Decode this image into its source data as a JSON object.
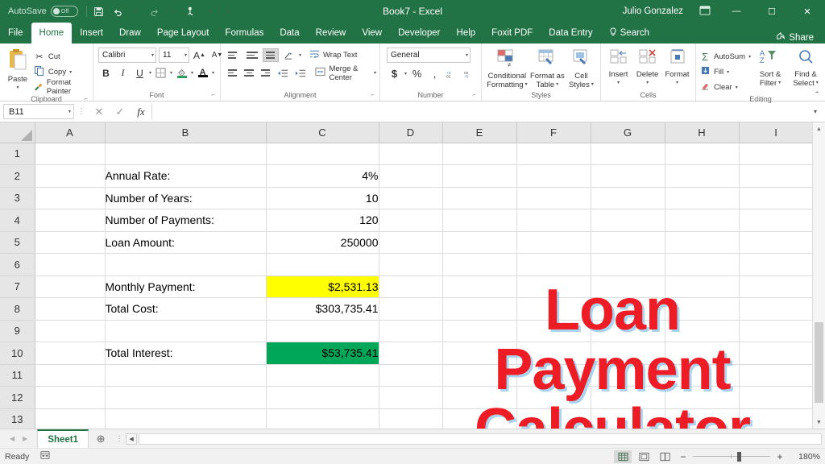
{
  "titlebar": {
    "autosave_label": "AutoSave",
    "autosave_state": "Off",
    "save_icon": "save-icon",
    "undo_icon": "undo-icon",
    "redo_icon": "redo-icon",
    "touch_icon": "touch-mode-icon",
    "customize_icon": "customize-qat-icon",
    "title": "Book7  -  Excel",
    "user": "Julio Gonzalez",
    "ribbon_display_icon": "ribbon-display-options-icon",
    "minimize": "—",
    "maximize": "☐",
    "close": "✕"
  },
  "tabs": [
    {
      "label": "File",
      "active": false
    },
    {
      "label": "Home",
      "active": true
    },
    {
      "label": "Insert",
      "active": false
    },
    {
      "label": "Draw",
      "active": false
    },
    {
      "label": "Page Layout",
      "active": false
    },
    {
      "label": "Formulas",
      "active": false
    },
    {
      "label": "Data",
      "active": false
    },
    {
      "label": "Review",
      "active": false
    },
    {
      "label": "View",
      "active": false
    },
    {
      "label": "Developer",
      "active": false
    },
    {
      "label": "Help",
      "active": false
    },
    {
      "label": "Foxit PDF",
      "active": false
    },
    {
      "label": "Data Entry",
      "active": false
    }
  ],
  "search": {
    "label": "Search",
    "icon": "lightbulb-icon"
  },
  "share": {
    "label": "Share",
    "icon": "share-icon"
  },
  "ribbon": {
    "clipboard": {
      "group_label": "Clipboard",
      "paste_label": "Paste",
      "cut_label": "Cut",
      "copy_label": "Copy",
      "format_painter_label": "Format Painter"
    },
    "font": {
      "group_label": "Font",
      "font_name": "Calibri",
      "font_size": "11",
      "grow_label": "A",
      "shrink_label": "A",
      "bold_label": "B",
      "italic_label": "I",
      "underline_label": "U",
      "borders_icon": "borders-icon",
      "fill_color_icon": "fill-color-icon",
      "font_color_icon": "font-color-icon",
      "fill_color": "#2e9e5b",
      "font_color": "#000000"
    },
    "alignment": {
      "group_label": "Alignment",
      "wrap_text_label": "Wrap Text",
      "merge_center_label": "Merge & Center",
      "orientation_icon": "orientation-icon",
      "decrease_indent_icon": "decrease-indent-icon",
      "increase_indent_icon": "increase-indent-icon"
    },
    "number": {
      "group_label": "Number",
      "format": "General",
      "currency_label": "$",
      "percent_label": "%",
      "comma_label": ",",
      "increase_decimal_icon": "increase-decimal-icon",
      "decrease_decimal_icon": "decrease-decimal-icon"
    },
    "styles": {
      "group_label": "Styles",
      "conditional_formatting_label": "Conditional\nFormatting",
      "conditional_formatting_l1": "Conditional",
      "conditional_formatting_l2": "Formatting",
      "format_as_table_l1": "Format as",
      "format_as_table_l2": "Table",
      "cell_styles_l1": "Cell",
      "cell_styles_l2": "Styles"
    },
    "cells": {
      "group_label": "Cells",
      "insert_label": "Insert",
      "delete_label": "Delete",
      "format_label": "Format"
    },
    "editing": {
      "group_label": "Editing",
      "autosum_label": "AutoSum",
      "fill_label": "Fill",
      "clear_label": "Clear",
      "sort_filter_l1": "Sort &",
      "sort_filter_l2": "Filter",
      "find_select_l1": "Find &",
      "find_select_l2": "Select",
      "collapse_icon": "collapse-ribbon-icon"
    }
  },
  "formulabar": {
    "name_box_value": "B11",
    "cancel_icon": "cancel-icon",
    "enter_icon": "enter-icon",
    "fx_icon": "insert-function-icon",
    "formula_value": "",
    "expand_icon": "expand-formula-bar-icon"
  },
  "grid": {
    "columns": [
      "A",
      "B",
      "C",
      "D",
      "E",
      "F",
      "G",
      "H",
      "I"
    ],
    "rows": [
      1,
      2,
      3,
      4,
      5,
      6,
      7,
      8,
      9,
      10,
      11,
      12,
      13
    ],
    "cells": [
      {
        "row": 2,
        "col": "B",
        "value": "Annual Rate:",
        "align": "left"
      },
      {
        "row": 2,
        "col": "C",
        "value": "4%",
        "align": "right"
      },
      {
        "row": 3,
        "col": "B",
        "value": "Number of Years:",
        "align": "left"
      },
      {
        "row": 3,
        "col": "C",
        "value": "10",
        "align": "right"
      },
      {
        "row": 4,
        "col": "B",
        "value": "Number of Payments:",
        "align": "left"
      },
      {
        "row": 4,
        "col": "C",
        "value": "120",
        "align": "right"
      },
      {
        "row": 5,
        "col": "B",
        "value": "Loan Amount:",
        "align": "left"
      },
      {
        "row": 5,
        "col": "C",
        "value": "250000",
        "align": "right"
      },
      {
        "row": 7,
        "col": "B",
        "value": "Monthly Payment:",
        "align": "left"
      },
      {
        "row": 7,
        "col": "C",
        "value": "$2,531.13",
        "align": "right",
        "highlight": "yellow"
      },
      {
        "row": 8,
        "col": "B",
        "value": "Total Cost:",
        "align": "left"
      },
      {
        "row": 8,
        "col": "C",
        "value": "$303,735.41",
        "align": "right"
      },
      {
        "row": 10,
        "col": "B",
        "value": "Total Interest:",
        "align": "left"
      },
      {
        "row": 10,
        "col": "C",
        "value": "$53,735.41",
        "align": "right",
        "highlight": "green"
      }
    ],
    "highlight_colors": {
      "yellow": "#ffff00",
      "green": "#00a759"
    }
  },
  "overlay": {
    "line1": "Loan",
    "line2": "Payment",
    "line3": "Calculator",
    "color": "#ee1c25",
    "shadow_color": "#9bcdeb"
  },
  "sheetbar": {
    "prev_icon": "prev-sheet-icon",
    "next_icon": "next-sheet-icon",
    "sheets": [
      "Sheet1"
    ],
    "active_sheet": "Sheet1",
    "add_sheet_label": "+"
  },
  "statusbar": {
    "state": "Ready",
    "accessibility_icon": "accessibility-icon",
    "normal_view_icon": "normal-view-icon",
    "page_layout_icon": "page-layout-view-icon",
    "page_break_icon": "page-break-view-icon",
    "zoom_out": "−",
    "zoom_in": "+",
    "zoom_level": "180%"
  }
}
